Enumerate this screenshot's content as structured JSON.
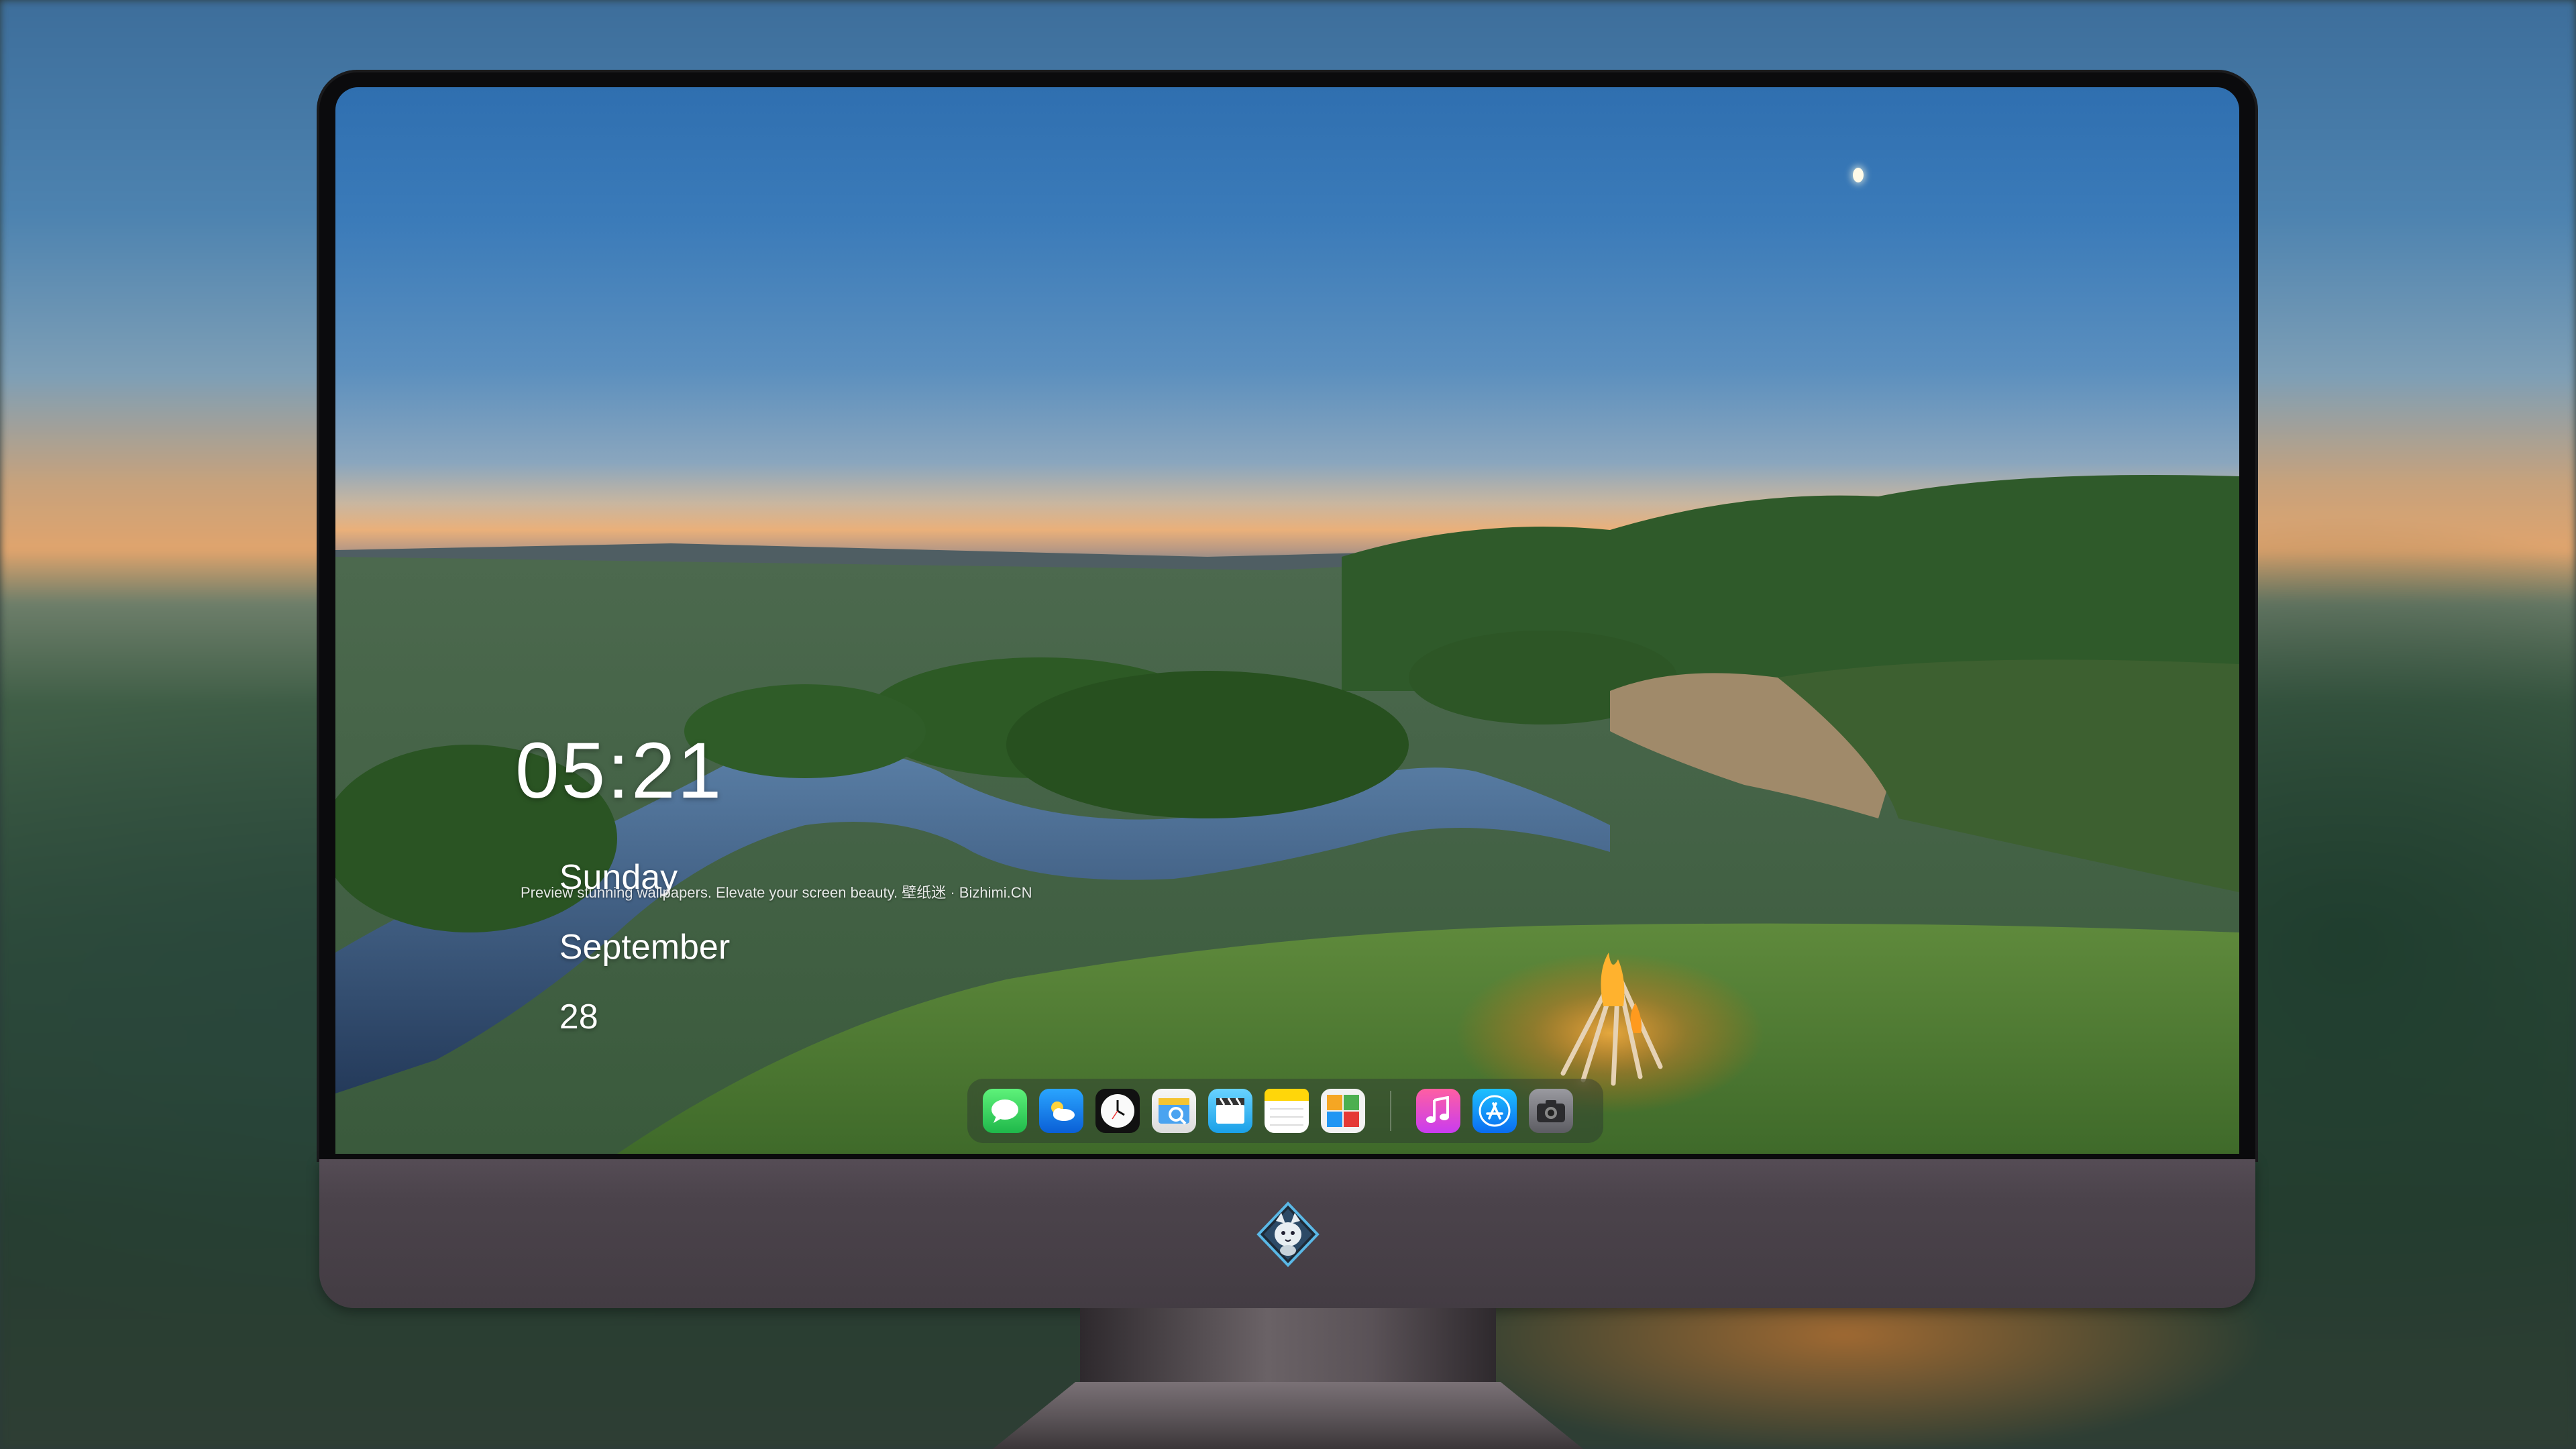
{
  "lock_screen": {
    "time": "05:21",
    "weekday": "Sunday",
    "month": "September",
    "day": "28",
    "tagline": "Preview stunning wallpapers. Elevate your screen beauty. 壁纸迷 · Bizhimi.CN"
  },
  "dock": {
    "apps": [
      {
        "name": "messages-icon",
        "color": "#34c759"
      },
      {
        "name": "weather-icon",
        "color": "#1e88e5"
      },
      {
        "name": "clock-icon",
        "color": "#f2f2f2"
      },
      {
        "name": "preview-icon",
        "color": "#f5c542"
      },
      {
        "name": "clips-icon",
        "color": "#5ac8fa"
      },
      {
        "name": "notes-icon",
        "color": "#ffd60a"
      },
      {
        "name": "photo-booth-icon",
        "color": "#e9e9e9"
      }
    ],
    "apps_secondary": [
      {
        "name": "music-icon",
        "color": "#fc3c8d"
      },
      {
        "name": "app-store-icon",
        "color": "#0a84ff"
      },
      {
        "name": "camera-icon",
        "color": "#6e6e73"
      }
    ]
  },
  "monitor": {
    "logo": "fox-mascot-logo"
  }
}
